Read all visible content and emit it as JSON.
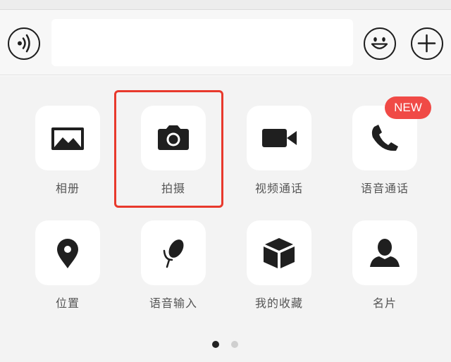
{
  "input_bar": {
    "voice_icon": "voice-waves-icon",
    "emoji_icon": "smiley-face-icon",
    "plus_icon": "plus-icon",
    "text_value": ""
  },
  "panel": {
    "items": [
      {
        "label": "相册",
        "icon": "image-icon"
      },
      {
        "label": "拍摄",
        "icon": "camera-icon"
      },
      {
        "label": "视频通话",
        "icon": "video-camera-icon"
      },
      {
        "label": "语音通话",
        "icon": "phone-icon"
      },
      {
        "label": "位置",
        "icon": "location-pin-icon"
      },
      {
        "label": "语音输入",
        "icon": "microphone-icon"
      },
      {
        "label": "我的收藏",
        "icon": "box-icon"
      },
      {
        "label": "名片",
        "icon": "person-icon"
      }
    ],
    "badge": "NEW",
    "highlighted_item": "拍摄"
  },
  "pager": {
    "current_page": 1,
    "total_pages": 2
  },
  "colors": {
    "accent_red": "#e8392c",
    "badge_red": "#f04a46",
    "icon_dark": "#1f1f1f",
    "label_gray": "#555555"
  }
}
